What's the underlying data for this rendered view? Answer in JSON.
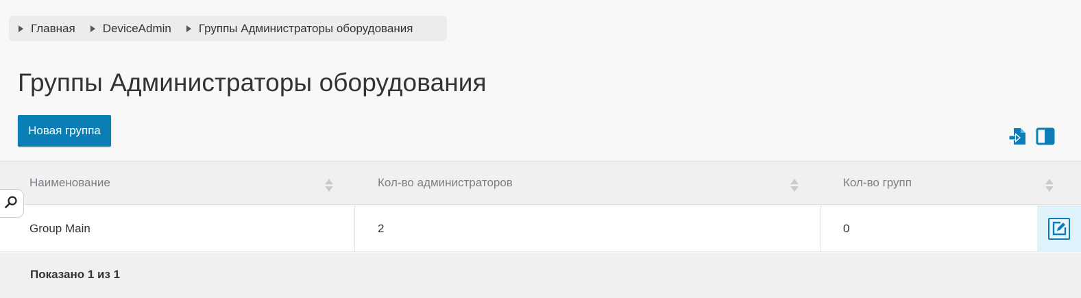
{
  "breadcrumb": {
    "items": [
      {
        "label": "Главная"
      },
      {
        "label": "DeviceAdmin"
      },
      {
        "label": "Группы Администраторы оборудования"
      }
    ]
  },
  "page": {
    "title": "Группы Администраторы оборудования",
    "new_button_label": "Новая группа"
  },
  "toolbar": {
    "icons": [
      "export-icon",
      "columns-icon"
    ]
  },
  "table": {
    "columns": [
      {
        "label": "Наименование"
      },
      {
        "label": "Кол-во администраторов"
      },
      {
        "label": "Кол-во групп"
      }
    ],
    "rows": [
      {
        "name": "Group Main",
        "admins": "2",
        "groups": "0"
      }
    ]
  },
  "footer": {
    "shown_text": "Показано 1 из 1"
  },
  "colors": {
    "accent": "#0a7eb5",
    "edit_cell_bg": "#dff1fb"
  }
}
